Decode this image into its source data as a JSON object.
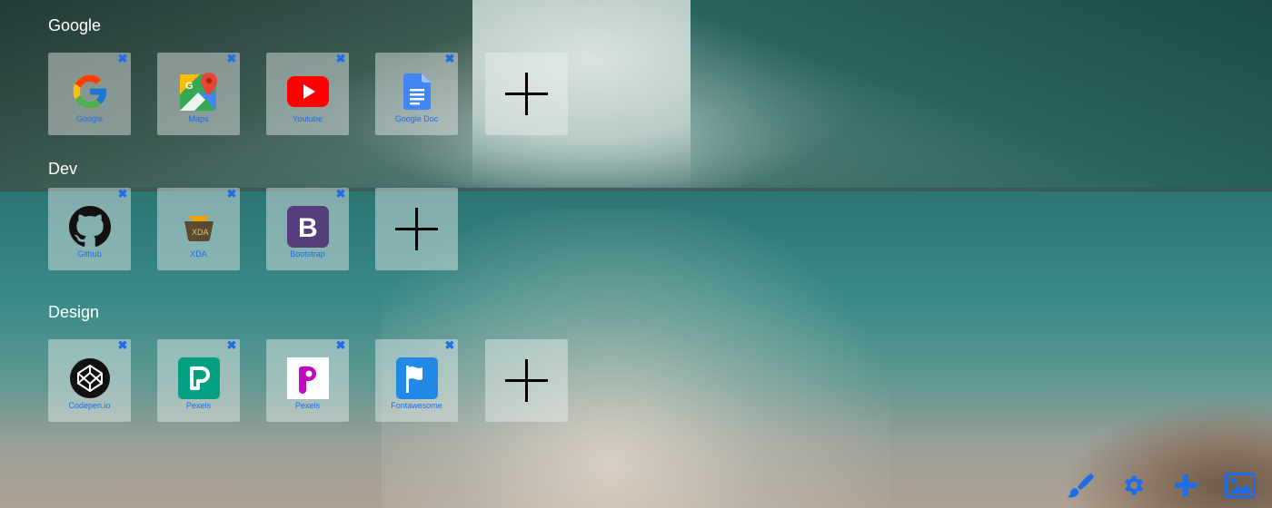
{
  "sections": [
    {
      "title": "Google",
      "items": [
        {
          "label": "Google",
          "icon": "google-icon"
        },
        {
          "label": "Maps",
          "icon": "maps-icon"
        },
        {
          "label": "Youtube",
          "icon": "youtube-icon"
        },
        {
          "label": "Google Doc",
          "icon": "google-docs-icon"
        }
      ]
    },
    {
      "title": "Dev",
      "items": [
        {
          "label": "Github",
          "icon": "github-icon"
        },
        {
          "label": "XDA",
          "icon": "xda-icon"
        },
        {
          "label": "Bootstrap",
          "icon": "bootstrap-icon"
        }
      ]
    },
    {
      "title": "Design",
      "items": [
        {
          "label": "Codepen.io",
          "icon": "codepen-icon"
        },
        {
          "label": "Pexels",
          "icon": "pexels-icon"
        },
        {
          "label": "Pexels",
          "icon": "picsart-icon"
        },
        {
          "label": "Fontawesome",
          "icon": "fontawesome-icon"
        }
      ]
    }
  ],
  "tile_close_glyph": "✖",
  "toolbar": {
    "items": [
      {
        "icon": "paint-brush-icon"
      },
      {
        "icon": "gear-icon"
      },
      {
        "icon": "plus-icon"
      },
      {
        "icon": "image-icon"
      }
    ]
  },
  "colors": {
    "accent": "#1e6de8",
    "tile_bg": "rgba(235,240,240,.45)",
    "title_text": "#ffffff"
  }
}
